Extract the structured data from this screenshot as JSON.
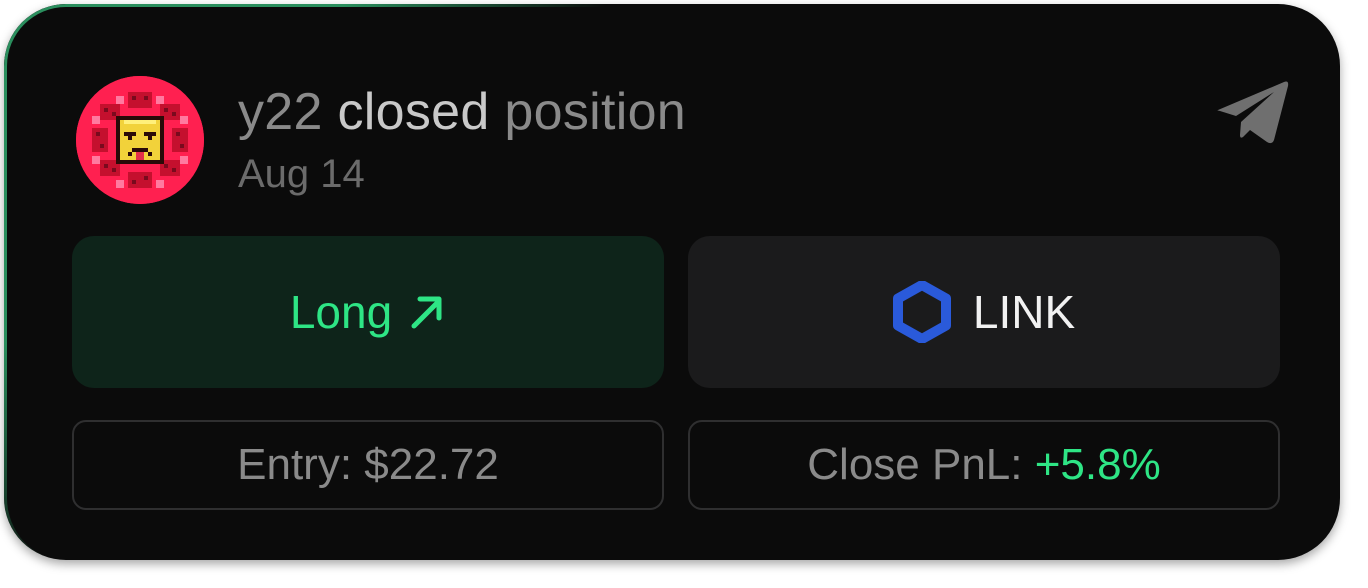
{
  "header": {
    "user": "y22",
    "action": "closed",
    "object": "position",
    "date": "Aug 14",
    "share_icon": "telegram-send-icon"
  },
  "avatar": {
    "icon": "pixel-flower-avatar",
    "bg_color": "#ff1f4d"
  },
  "direction": {
    "label": "Long",
    "arrow_icon": "arrow-up-right-icon",
    "color": "#2ee585"
  },
  "token": {
    "symbol": "LINK",
    "icon": "chainlink-hexagon-icon",
    "icon_color": "#2a5ada"
  },
  "stats": {
    "entry_label": "Entry:",
    "entry_value": "$22.72",
    "pnl_label": "Close PnL:",
    "pnl_value": "+5.8%",
    "pnl_color": "#2ee585"
  }
}
